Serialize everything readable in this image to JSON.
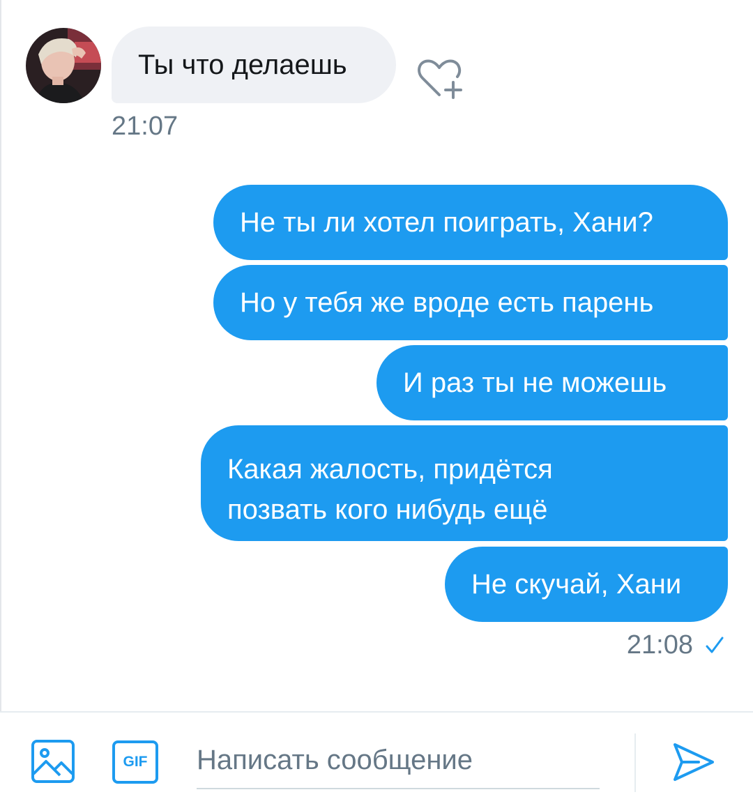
{
  "colors": {
    "accent": "#1d9bf0",
    "incoming_bubble": "#eff1f5",
    "secondary_text": "#657786"
  },
  "incoming": {
    "text": "Ты что делаешь",
    "time": "21:07",
    "avatar_icon": "user-avatar-photo",
    "like_icon": "heart-plus-icon"
  },
  "outgoing": {
    "messages": [
      {
        "text": "Не ты ли хотел поиграть, Хани?"
      },
      {
        "text": "Но у тебя же вроде есть парень"
      },
      {
        "text": "И раз ты не можешь"
      },
      {
        "line1": "Какая жалость, придётся",
        "line2": "позвать кого нибудь ещё"
      },
      {
        "text": "Не скучай, Хани"
      }
    ],
    "time": "21:08",
    "status_icon": "sent-check-icon"
  },
  "composer": {
    "placeholder": "Написать сообщение",
    "media_icon": "image-icon",
    "gif_label": "GIF",
    "send_icon": "send-icon"
  }
}
